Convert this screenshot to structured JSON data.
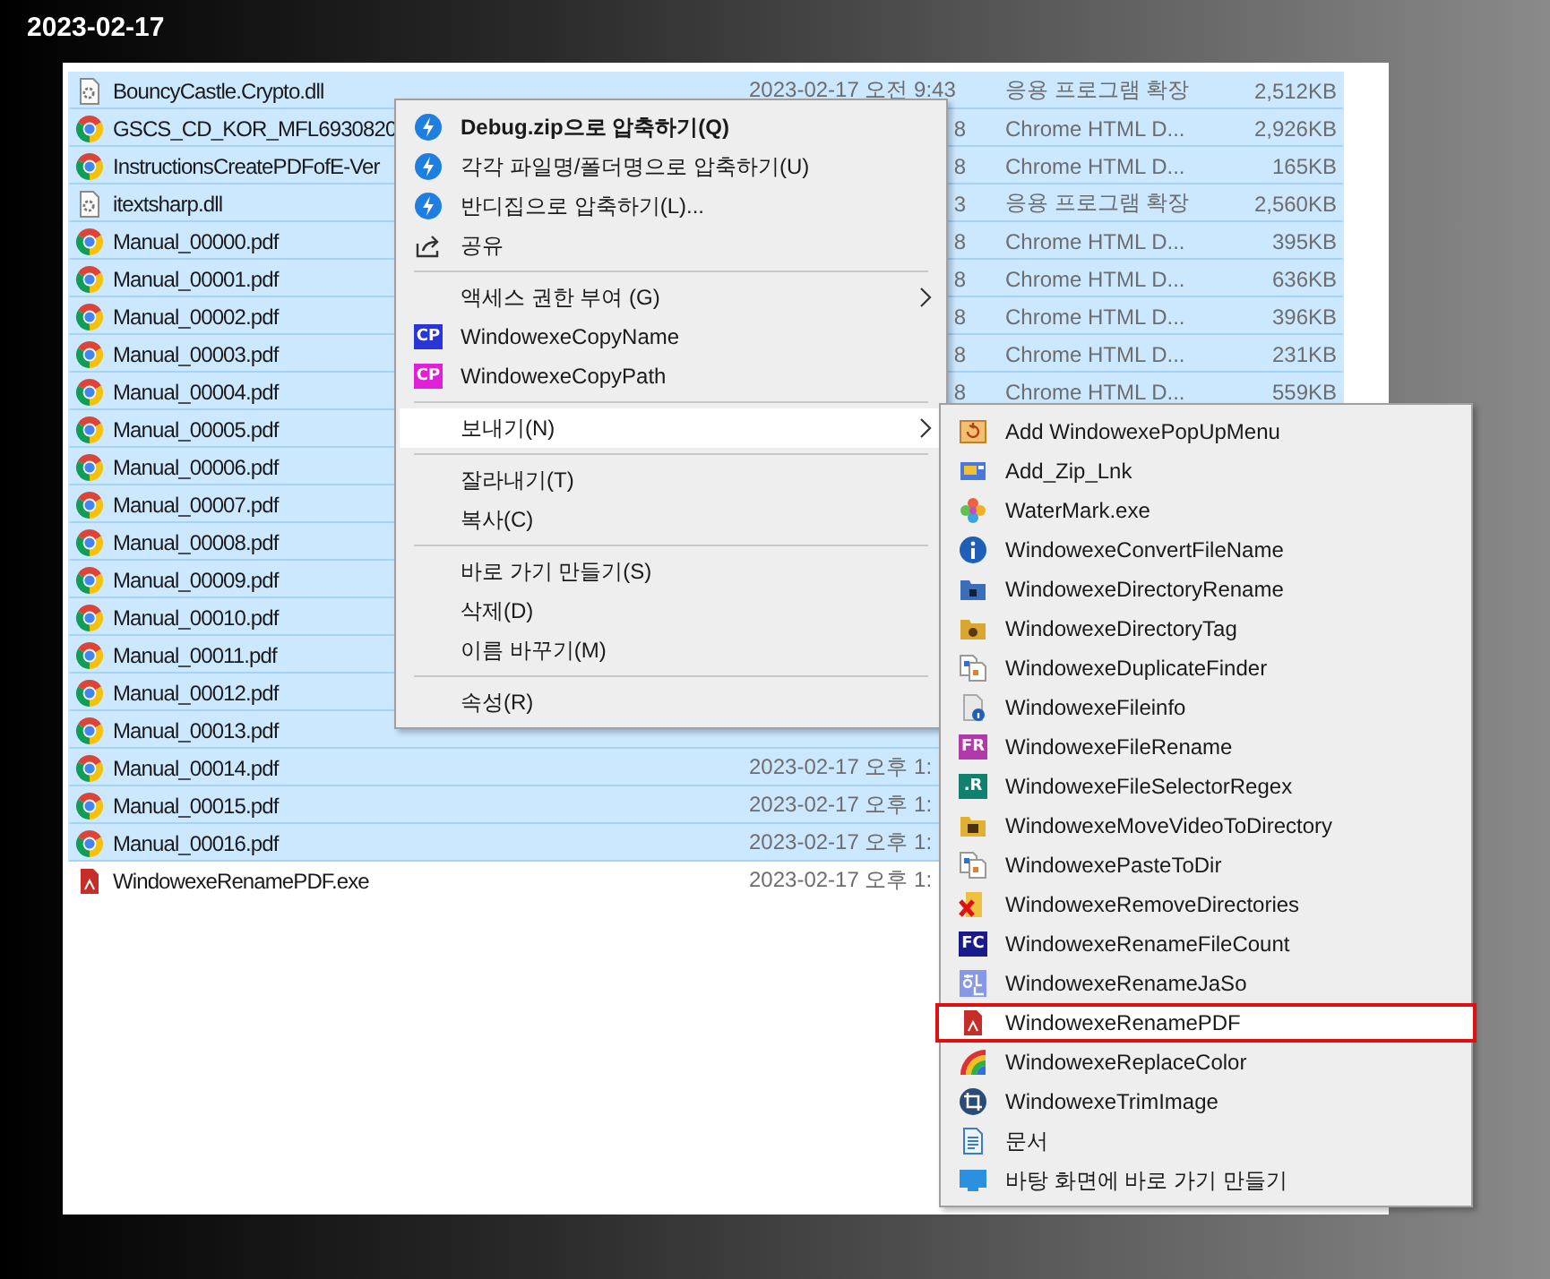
{
  "caption": "2023-02-17",
  "files": [
    {
      "name": "BouncyCastle.Crypto.dll",
      "kind": "dll",
      "selected": true,
      "date": "2023-02-17 오전 9:43",
      "type": "응용 프로그램 확장",
      "size": "2,512KB"
    },
    {
      "name": "GSCS_CD_KOR_MFL6930820",
      "kind": "html",
      "selected": true,
      "date": "8",
      "type": "Chrome HTML D...",
      "size": "2,926KB"
    },
    {
      "name": "InstructionsCreatePDFofE-Ver",
      "kind": "html",
      "selected": true,
      "date": "8",
      "type": "Chrome HTML D...",
      "size": "165KB"
    },
    {
      "name": "itextsharp.dll",
      "kind": "dll",
      "selected": true,
      "date": "3",
      "type": "응용 프로그램 확장",
      "size": "2,560KB"
    },
    {
      "name": "Manual_00000.pdf",
      "kind": "html",
      "selected": true,
      "date": "8",
      "type": "Chrome HTML D...",
      "size": "395KB"
    },
    {
      "name": "Manual_00001.pdf",
      "kind": "html",
      "selected": true,
      "date": "8",
      "type": "Chrome HTML D...",
      "size": "636KB"
    },
    {
      "name": "Manual_00002.pdf",
      "kind": "html",
      "selected": true,
      "date": "8",
      "type": "Chrome HTML D...",
      "size": "396KB"
    },
    {
      "name": "Manual_00003.pdf",
      "kind": "html",
      "selected": true,
      "date": "8",
      "type": "Chrome HTML D...",
      "size": "231KB"
    },
    {
      "name": "Manual_00004.pdf",
      "kind": "html",
      "selected": true,
      "date": "8",
      "type": "Chrome HTML D...",
      "size": "559KB"
    },
    {
      "name": "Manual_00005.pdf",
      "kind": "html",
      "selected": true
    },
    {
      "name": "Manual_00006.pdf",
      "kind": "html",
      "selected": true
    },
    {
      "name": "Manual_00007.pdf",
      "kind": "html",
      "selected": true
    },
    {
      "name": "Manual_00008.pdf",
      "kind": "html",
      "selected": true
    },
    {
      "name": "Manual_00009.pdf",
      "kind": "html",
      "selected": true
    },
    {
      "name": "Manual_00010.pdf",
      "kind": "html",
      "selected": true
    },
    {
      "name": "Manual_00011.pdf",
      "kind": "html",
      "selected": true
    },
    {
      "name": "Manual_00012.pdf",
      "kind": "html",
      "selected": true
    },
    {
      "name": "Manual_00013.pdf",
      "kind": "html",
      "selected": true
    },
    {
      "name": "Manual_00014.pdf",
      "kind": "html",
      "selected": true,
      "date": "2023-02-17 오후 1:"
    },
    {
      "name": "Manual_00015.pdf",
      "kind": "html",
      "selected": true,
      "date": "2023-02-17 오후 1:"
    },
    {
      "name": "Manual_00016.pdf",
      "kind": "html",
      "selected": true,
      "date": "2023-02-17 오후 1:"
    },
    {
      "name": "WindowexeRenamePDF.exe",
      "kind": "exe",
      "selected": false,
      "date": "2023-02-17 오후 1:"
    }
  ],
  "context_menu": {
    "items": [
      {
        "kind": "item",
        "label": "Debug.zip으로 압축하기(Q)",
        "default": true,
        "submenu": false,
        "selected": false
      },
      {
        "kind": "item",
        "label": "각각 파일명/폴더명으로 압축하기(U)",
        "default": false,
        "submenu": false,
        "selected": false
      },
      {
        "kind": "item",
        "label": "반디집으로 압축하기(L)...",
        "default": false,
        "submenu": false,
        "selected": false
      },
      {
        "kind": "item",
        "label": "공유",
        "default": false,
        "submenu": false,
        "selected": false
      },
      {
        "kind": "separator"
      },
      {
        "kind": "item",
        "label": "액세스 권한 부여 (G)",
        "default": false,
        "submenu": true,
        "selected": false
      },
      {
        "kind": "item",
        "label": "WindowexeCopyName",
        "default": false,
        "submenu": false,
        "selected": false,
        "icon_label": "CP",
        "color": "#2a35d8"
      },
      {
        "kind": "item",
        "label": "WindowexeCopyPath",
        "default": false,
        "submenu": false,
        "selected": false,
        "icon_label": "CP",
        "color": "#e020d8"
      },
      {
        "kind": "separator"
      },
      {
        "kind": "item",
        "label": "보내기(N)",
        "default": false,
        "submenu": true,
        "selected": true
      },
      {
        "kind": "separator"
      },
      {
        "kind": "item",
        "label": "잘라내기(T)",
        "default": false,
        "submenu": false,
        "selected": false
      },
      {
        "kind": "item",
        "label": "복사(C)",
        "default": false,
        "submenu": false,
        "selected": false
      },
      {
        "kind": "separator"
      },
      {
        "kind": "item",
        "label": "바로 가기 만들기(S)",
        "default": false,
        "submenu": false,
        "selected": false
      },
      {
        "kind": "item",
        "label": "삭제(D)",
        "default": false,
        "submenu": false,
        "selected": false
      },
      {
        "kind": "item",
        "label": "이름 바꾸기(M)",
        "default": false,
        "submenu": false,
        "selected": false
      },
      {
        "kind": "separator"
      },
      {
        "kind": "item",
        "label": "속성(R)",
        "default": false,
        "submenu": false,
        "selected": false
      }
    ]
  },
  "send_to_menu": {
    "items": [
      {
        "kind": "item",
        "label": "Add WindowexePopUpMenu",
        "outlined": false
      },
      {
        "kind": "item",
        "label": "Add_Zip_Lnk",
        "outlined": false
      },
      {
        "kind": "item",
        "label": "WaterMark.exe",
        "outlined": false
      },
      {
        "kind": "item",
        "label": "WindowexeConvertFileName",
        "outlined": false
      },
      {
        "kind": "item",
        "label": "WindowexeDirectoryRename",
        "outlined": false
      },
      {
        "kind": "item",
        "label": "WindowexeDirectoryTag",
        "outlined": false
      },
      {
        "kind": "item",
        "label": "WindowexeDuplicateFinder",
        "outlined": false
      },
      {
        "kind": "item",
        "label": "WindowexeFileinfo",
        "outlined": false
      },
      {
        "kind": "item",
        "label": "WindowexeFileRename",
        "outlined": false,
        "icon_label": "FR",
        "color": "#b03aa8"
      },
      {
        "kind": "item",
        "label": "WindowexeFileSelectorRegex",
        "outlined": false,
        "icon_label": ".R",
        "color": "#12806e"
      },
      {
        "kind": "item",
        "label": "WindowexeMoveVideoToDirectory",
        "outlined": false
      },
      {
        "kind": "item",
        "label": "WindowexePasteToDir",
        "outlined": false
      },
      {
        "kind": "item",
        "label": "WindowexeRemoveDirectories",
        "outlined": false
      },
      {
        "kind": "item",
        "label": "WindowexeRenameFileCount",
        "outlined": false,
        "icon_label": "FC",
        "color": "#1a1a8a"
      },
      {
        "kind": "item",
        "label": "WindowexeRenameJaSo",
        "outlined": false
      },
      {
        "kind": "item",
        "label": "WindowexeRenamePDF",
        "outlined": true
      },
      {
        "kind": "item",
        "label": "WindowexeReplaceColor",
        "outlined": false
      },
      {
        "kind": "item",
        "label": "WindowexeTrimImage",
        "outlined": false
      },
      {
        "kind": "item",
        "label": "문서",
        "outlined": false
      },
      {
        "kind": "item",
        "label": "바탕 화면에 바로 가기 만들기",
        "outlined": false
      }
    ]
  }
}
